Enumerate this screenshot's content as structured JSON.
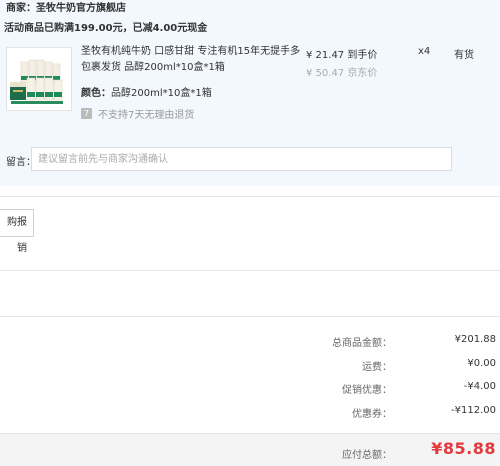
{
  "shop": {
    "label": "商家：",
    "name": "圣牧牛奶官方旗舰店"
  },
  "promo": {
    "text": "活动商品已购满199.00元，已减4.00元现金"
  },
  "product": {
    "title": "圣牧有机纯牛奶 口感甘甜 专注有机15年无提手多包裹发货 品醇200ml*10盒*1箱",
    "color_label": "颜色：",
    "color_value": "品醇200ml*10盒*1箱",
    "return_icon": "7",
    "return_text": "不支持7天无理由退货",
    "price": "¥ 21.47 到手价",
    "jd_price": "¥ 50.47 京东价",
    "qty": "x4",
    "stock": "有货"
  },
  "message": {
    "label": "留言：",
    "placeholder": "建议留言前先与商家沟通确认"
  },
  "invoice": {
    "button_label": "购报销"
  },
  "summary": {
    "rows": [
      {
        "label": "总商品金额：",
        "value": "¥201.88"
      },
      {
        "label": "运费：",
        "value": "¥0.00"
      },
      {
        "label": "促销优惠：",
        "value": "-¥4.00"
      },
      {
        "label": "优惠券：",
        "value": "-¥112.00"
      }
    ],
    "payable_label": "应付总额：",
    "payable_value": "¥85.88"
  },
  "colors": {
    "accent_red": "#e4393c",
    "panel_blue": "#f3f8fe"
  }
}
